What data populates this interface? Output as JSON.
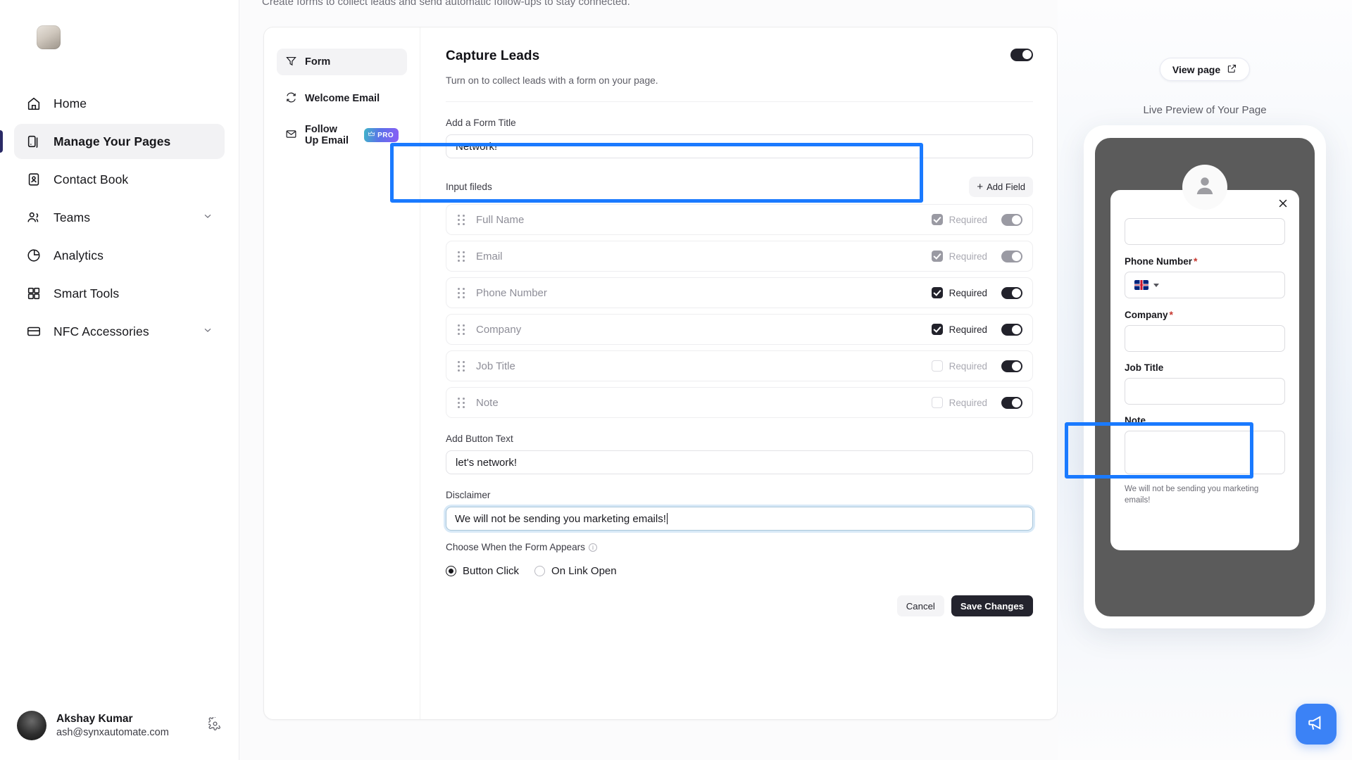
{
  "page": {
    "subtitle": "Create forms to collect leads and send automatic follow-ups to stay connected."
  },
  "sidebar": {
    "items": [
      {
        "label": "Home",
        "icon": "home-icon",
        "active": false,
        "chevron": false
      },
      {
        "label": "Manage Your Pages",
        "icon": "pages-icon",
        "active": true,
        "chevron": false
      },
      {
        "label": "Contact Book",
        "icon": "contact-book-icon",
        "active": false,
        "chevron": false
      },
      {
        "label": "Teams",
        "icon": "users-icon",
        "active": false,
        "chevron": true
      },
      {
        "label": "Analytics",
        "icon": "pie-chart-icon",
        "active": false,
        "chevron": false
      },
      {
        "label": "Smart Tools",
        "icon": "grid-icon",
        "active": false,
        "chevron": false
      },
      {
        "label": "NFC Accessories",
        "icon": "card-icon",
        "active": false,
        "chevron": true
      }
    ],
    "user": {
      "name": "Akshay Kumar",
      "email": "ash@synxautomate.com",
      "settings_icon": "gear-icon"
    }
  },
  "tabs": [
    {
      "label": "Form",
      "icon": "filter-icon",
      "active": true,
      "pro": false
    },
    {
      "label": "Welcome Email",
      "icon": "refresh-icon",
      "active": false,
      "pro": false
    },
    {
      "label": "Follow Up Email",
      "icon": "mail-check-icon",
      "active": false,
      "pro": true,
      "pro_label": "PRO"
    }
  ],
  "panel": {
    "title": "Capture Leads",
    "description": "Turn on to collect leads with a form on your page.",
    "master_toggle_on": true,
    "form_title_label": "Add a Form Title",
    "form_title_value": "Network!",
    "fields_label": "Input fileds",
    "add_field_label": "Add Field",
    "required_label": "Required",
    "fields": [
      {
        "name": "Full Name",
        "checkbox": "checked-gray",
        "toggle": "on-gray",
        "muted": true
      },
      {
        "name": "Email",
        "checkbox": "checked-gray",
        "toggle": "on-gray",
        "muted": true
      },
      {
        "name": "Phone Number",
        "checkbox": "checked-dark",
        "toggle": "on-dark",
        "muted": false
      },
      {
        "name": "Company",
        "checkbox": "checked-dark",
        "toggle": "on-dark",
        "muted": false
      },
      {
        "name": "Job Title",
        "checkbox": "empty",
        "toggle": "on-dark",
        "muted": true
      },
      {
        "name": "Note",
        "checkbox": "empty",
        "toggle": "on-dark",
        "muted": true
      }
    ],
    "button_text_label": "Add Button Text",
    "button_text_value": "let's network!",
    "disclaimer_label": "Disclaimer",
    "disclaimer_value": "We will not be sending you marketing emails!",
    "when_label": "Choose When the Form Appears",
    "radio_options": [
      {
        "label": "Button Click",
        "selected": true
      },
      {
        "label": "On Link Open",
        "selected": false
      }
    ],
    "cancel_label": "Cancel",
    "save_label": "Save Changes"
  },
  "preview": {
    "view_page_label": "View page",
    "view_page_icon": "external-link-icon",
    "live_label": "Live Preview of Your Page",
    "close_icon": "close-icon",
    "avatar_icon": "person-icon",
    "fields": [
      {
        "label": "",
        "type": "text"
      },
      {
        "label": "Phone Number",
        "required": true,
        "type": "phone"
      },
      {
        "label": "Company",
        "required": true,
        "type": "text"
      },
      {
        "label": "Job Title",
        "required": false,
        "type": "text"
      },
      {
        "label": "Note",
        "required": false,
        "type": "textarea"
      }
    ],
    "disclaimer": "We will not be sending you marketing emails!"
  },
  "fab": {
    "icon": "megaphone-icon"
  },
  "colors": {
    "accent_dark": "#22222b",
    "highlight_blue": "#1a7aff",
    "fab_blue": "#3b82f6",
    "required_star": "#c7372f",
    "sidebar_active_bar": "#2a2a66"
  }
}
